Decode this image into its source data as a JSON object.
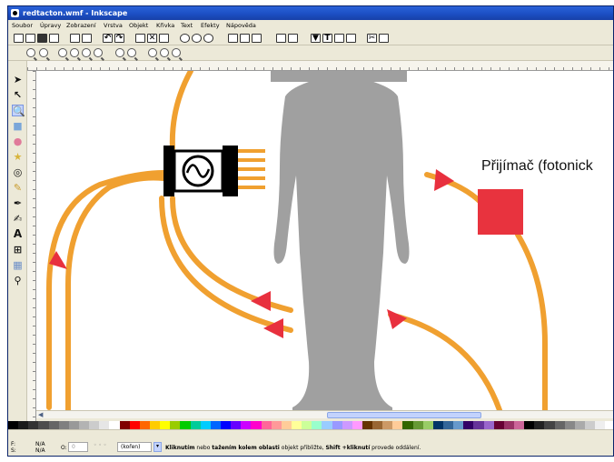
{
  "window": {
    "title": "redtacton.wmf - Inkscape"
  },
  "menu": [
    "Soubor",
    "Úpravy",
    "Zobrazení",
    "Vrstva",
    "Objekt",
    "Křivka",
    "Text",
    "Efekty",
    "Nápověda"
  ],
  "canvas": {
    "receiver_label": "Přijímač (fotonick"
  },
  "statusbar": {
    "fill_label": "F:",
    "fill_value": "N/A",
    "stroke_label": "S:",
    "stroke_value": "N/A",
    "opacity_label": "O:",
    "opacity_value": "0",
    "layer_value": "(kořen)",
    "message_part1": "Kliknutím",
    "message_part2": " nebo ",
    "message_part3": "tažením kolem oblasti",
    "message_part4": " objekt přibližte, ",
    "message_part5": "Shift +kliknutí",
    "message_part6": " provede oddálení."
  },
  "colors": {
    "wire": "#f0a030",
    "arrow": "#e8303e",
    "receiver": "#e8333e",
    "body": "#a0a0a0",
    "titlebar": "#1c4fc4"
  },
  "palette": [
    "#000000",
    "#1a1a1a",
    "#333333",
    "#4d4d4d",
    "#666666",
    "#808080",
    "#999999",
    "#b3b3b3",
    "#cccccc",
    "#e6e6e6",
    "#ffffff",
    "#800000",
    "#ff0000",
    "#ff6600",
    "#ffcc00",
    "#ffff00",
    "#99cc00",
    "#00cc00",
    "#00cc99",
    "#00ccff",
    "#0066ff",
    "#0000ff",
    "#6600ff",
    "#cc00ff",
    "#ff00cc",
    "#ff6699",
    "#ff9999",
    "#ffcc99",
    "#ffff99",
    "#ccff99",
    "#99ffcc",
    "#99ccff",
    "#9999ff",
    "#cc99ff",
    "#ff99ff",
    "#663300",
    "#996633",
    "#cc9966",
    "#ffcc99",
    "#336600",
    "#669933",
    "#99cc66",
    "#003366",
    "#336699",
    "#6699cc",
    "#330066",
    "#663399",
    "#9966cc",
    "#660033",
    "#993366",
    "#cc6699",
    "#000000",
    "#222222",
    "#444444",
    "#666666",
    "#888888",
    "#aaaaaa",
    "#cccccc",
    "#eeeeee",
    "#ffffff"
  ],
  "tools": [
    "selector-tool",
    "node-tool",
    "zoom-tool",
    "rectangle-tool",
    "ellipse-tool",
    "star-tool",
    "spiral-tool",
    "pencil-tool",
    "pen-tool",
    "calligraphy-tool",
    "text-tool",
    "connector-tool",
    "gradient-tool",
    "dropper-tool"
  ]
}
